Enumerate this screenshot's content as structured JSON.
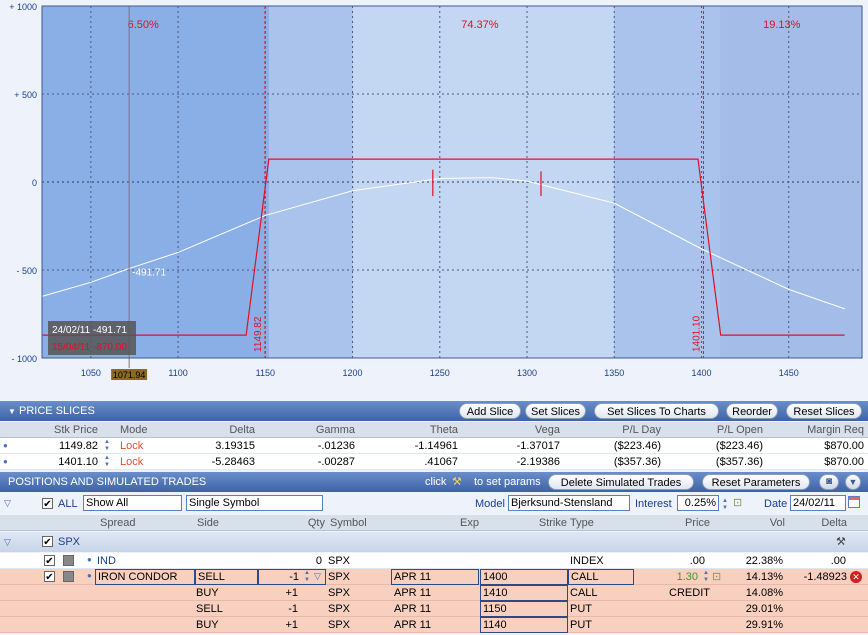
{
  "chart": {
    "y_ticks": [
      "+ 1000",
      "+ 500",
      "0",
      "- 500",
      "- 1000"
    ],
    "x_ticks": [
      "1050",
      "1100",
      "1150",
      "1200",
      "1250",
      "1300",
      "1350",
      "1400",
      "1450"
    ],
    "region_pcts": [
      "6.50%",
      "74.37%",
      "19.13%"
    ],
    "cursor_label": "1071.94",
    "cursor_value": "-491.71",
    "tooltip_line1": "24/02/11  -491.71",
    "tooltip_line2": "15/04/11  -870.00",
    "slice_label_1": "1149.82",
    "slice_label_2": "1401.10",
    "colors": {
      "pl_line": "#e0102a",
      "today_line": "#ffffff",
      "bg_dark": "#8aaee6",
      "bg_light": "#c3d6f2"
    }
  },
  "chart_data": {
    "type": "line",
    "xlim": [
      1022,
      1492
    ],
    "ylim": [
      -1000,
      1000
    ],
    "xlabel": "",
    "ylabel": "",
    "grid": true,
    "series": [
      {
        "x": [
          1022,
          1139,
          1152,
          1398,
          1411,
          1482
        ],
        "y": [
          -870,
          -870,
          130,
          130,
          -870,
          -870
        ]
      },
      {
        "x": [
          1022,
          1050,
          1071.94,
          1100,
          1150,
          1200,
          1250,
          1280,
          1300,
          1350,
          1400,
          1450,
          1482
        ],
        "y": [
          -650,
          -570,
          -491.71,
          -400,
          -190,
          -50,
          20,
          25,
          5,
          -120,
          -380,
          -610,
          -720
        ]
      }
    ]
  },
  "price_slices": {
    "title": "PRICE SLICES",
    "buttons": [
      "Add Slice",
      "Set Slices",
      "Set Slices To Charts",
      "Reorder",
      "Reset Slices"
    ],
    "columns": [
      "Stk Price",
      "Mode",
      "Delta",
      "Gamma",
      "Theta",
      "Vega",
      "P/L Day",
      "P/L Open",
      "Margin Req"
    ],
    "rows": [
      [
        "1149.82",
        "Lock",
        "3.19315",
        "-.01236",
        "-1.14961",
        "-1.37017",
        "($223.46)",
        "($223.46)",
        "$870.00"
      ],
      [
        "1401.10",
        "Lock",
        "-5.28463",
        "-.00287",
        ".41067",
        "-2.19386",
        "($357.36)",
        "($357.36)",
        "$870.00"
      ]
    ]
  },
  "positions": {
    "title": "POSITIONS AND SIMULATED TRADES",
    "click_text": "click",
    "set_params_text": "to set params",
    "delete_button": "Delete Simulated Trades",
    "reset_button": "Reset Parameters",
    "all_label": "ALL",
    "show_value": "Show All",
    "symbol_mode_value": "Single Symbol",
    "model_label": "Model",
    "model_value": "Bjerksund-Stensland",
    "interest_label": "Interest",
    "interest_value": "0.25%",
    "date_label": "Date",
    "date_value": "24/02/11",
    "columns": [
      "Spread",
      "Side",
      "Qty",
      "Symbol",
      "Exp",
      "Strike",
      "Type",
      "Price",
      "Vol",
      "Delta"
    ],
    "group": "SPX",
    "ind_row": [
      "IND",
      "",
      "0",
      "SPX",
      "",
      "",
      "INDEX",
      ".00",
      "22.38%",
      ".00"
    ],
    "condor_rows": [
      [
        "IRON CONDOR",
        "SELL",
        "-1",
        "SPX",
        "APR 11",
        "1400",
        "CALL",
        "1.30",
        "14.13%",
        "-1.48923"
      ],
      [
        "",
        "BUY",
        "+1",
        "SPX",
        "APR 11",
        "1410",
        "CALL",
        "CREDIT",
        "14.08%",
        ""
      ],
      [
        "",
        "SELL",
        "-1",
        "SPX",
        "APR 11",
        "1150",
        "PUT",
        "",
        "29.01%",
        ""
      ],
      [
        "",
        "BUY",
        "+1",
        "SPX",
        "APR 11",
        "1140",
        "PUT",
        "",
        "29.91%",
        ""
      ]
    ]
  }
}
